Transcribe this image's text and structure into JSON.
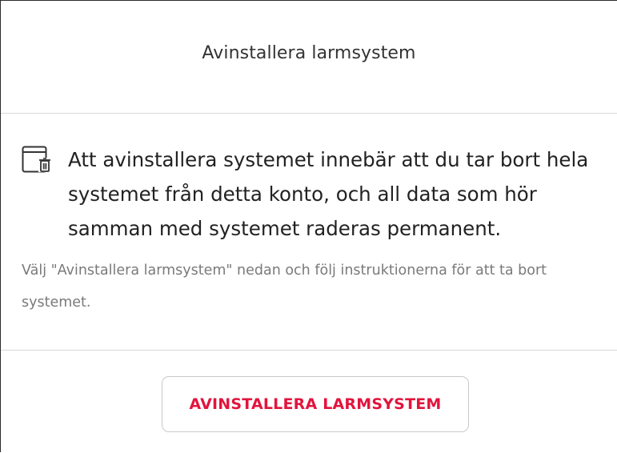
{
  "dialog": {
    "title": "Avinstallera larmsystem",
    "icon": "window-trash-icon",
    "main_text": "Att avinstallera systemet innebär att du tar bort hela systemet från detta konto, och all data som hör samman med systemet raderas permanent.",
    "sub_text": "Välj \"Avinstallera larmsystem\" nedan och följ instruktionerna för att ta bort systemet.",
    "button_label": "AVINSTALLERA LARMSYSTEM"
  },
  "colors": {
    "accent": "#e2143d",
    "title_text": "#333333",
    "body_text": "#222222",
    "muted_text": "#7a7a7a",
    "divider": "#d9d9d9",
    "button_border": "#c9c9c9"
  }
}
